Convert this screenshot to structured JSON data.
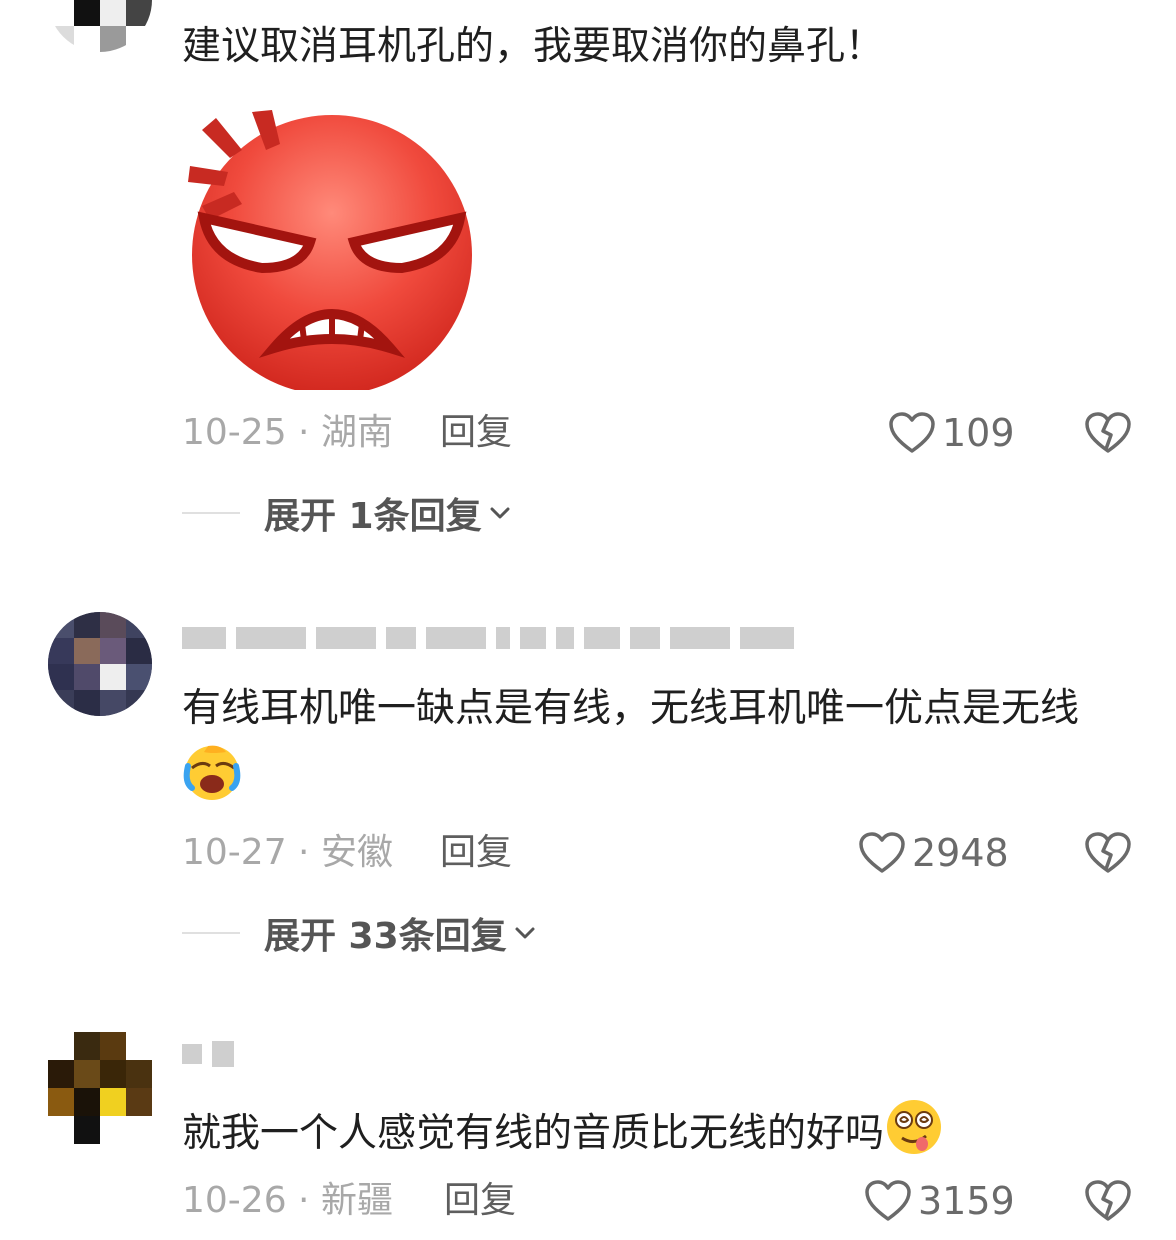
{
  "comments": [
    {
      "text": "建议取消耳机孔的，我要取消你的鼻孔！",
      "date_location": "10-25 · 湖南",
      "reply_label": "回复",
      "likes": "109",
      "expand_label": "展开 1条回复"
    },
    {
      "text": "有线耳机唯一缺点是有线，无线耳机唯一优点是无线",
      "date_location": "10-27 · 安徽",
      "reply_label": "回复",
      "likes": "2948",
      "expand_label": "展开 33条回复"
    },
    {
      "text": "就我一个人感觉有线的音质比无线的好吗",
      "date_location": "10-26 · 新疆",
      "reply_label": "回复",
      "likes": "3159"
    }
  ],
  "icons": {
    "like": "heart-outline-icon",
    "dislike": "broken-heart-icon",
    "expand": "chevron-down-icon",
    "sticker": "angry-face-sticker",
    "emoji_2": "laughing-crying-emoji",
    "emoji_3": "dizzy-tongue-emoji"
  },
  "colors": {
    "text": "#1f1f1f",
    "meta": "#a8a8a8",
    "accent_sticker": "#e8392f"
  }
}
